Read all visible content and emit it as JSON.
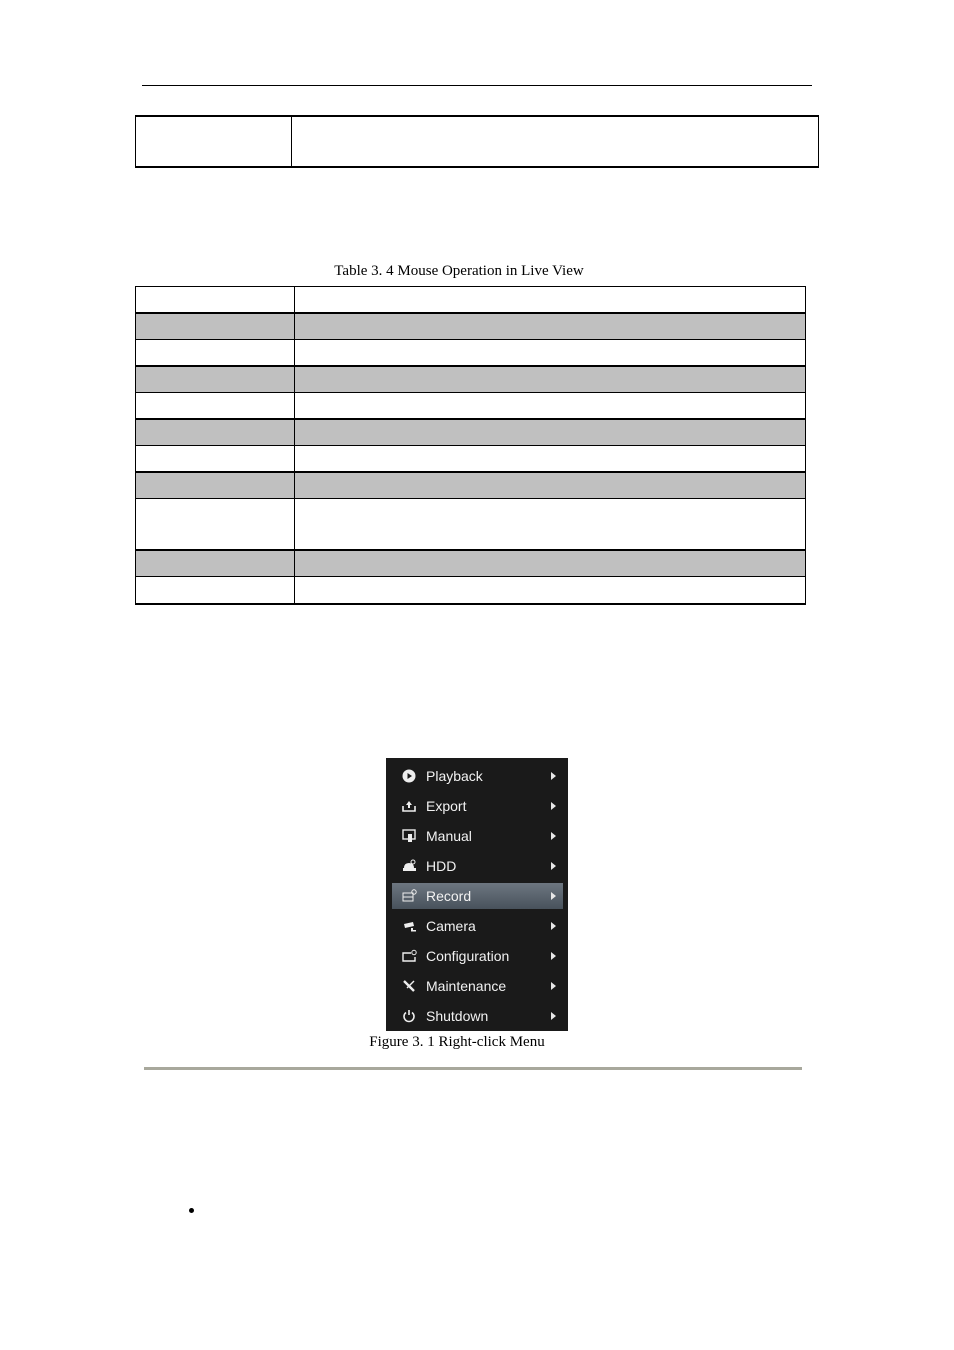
{
  "table": {
    "caption": "Table 3. 4 Mouse Operation in Live View",
    "rows": [
      {
        "col1": "",
        "col2": "",
        "shaded": false
      },
      {
        "col1": "",
        "col2": "",
        "shaded": true
      },
      {
        "col1": "",
        "col2": "",
        "shaded": false
      },
      {
        "col1": "",
        "col2": "",
        "shaded": true
      },
      {
        "col1": "",
        "col2": "",
        "shaded": false
      },
      {
        "col1": "",
        "col2": "",
        "shaded": true
      },
      {
        "col1": "",
        "col2": "",
        "shaded": false
      },
      {
        "col1": "",
        "col2": "",
        "shaded": true
      },
      {
        "col1": "",
        "col2": "",
        "shaded": false
      },
      {
        "col1": "",
        "col2": "",
        "shaded": true
      },
      {
        "col1": "",
        "col2": "",
        "shaded": false
      }
    ]
  },
  "menu": {
    "items": [
      {
        "label": "Playback",
        "icon": "play-icon",
        "active": false
      },
      {
        "label": "Export",
        "icon": "export-icon",
        "active": false
      },
      {
        "label": "Manual",
        "icon": "manual-icon",
        "active": false
      },
      {
        "label": "HDD",
        "icon": "hdd-icon",
        "active": false
      },
      {
        "label": "Record",
        "icon": "record-icon",
        "active": true
      },
      {
        "label": "Camera",
        "icon": "camera-icon",
        "active": false
      },
      {
        "label": "Configuration",
        "icon": "configuration-icon",
        "active": false
      },
      {
        "label": "Maintenance",
        "icon": "maintenance-icon",
        "active": false
      },
      {
        "label": "Shutdown",
        "icon": "power-icon",
        "active": false
      }
    ]
  },
  "figure": {
    "caption": "Figure 3. 1 Right-click Menu"
  }
}
